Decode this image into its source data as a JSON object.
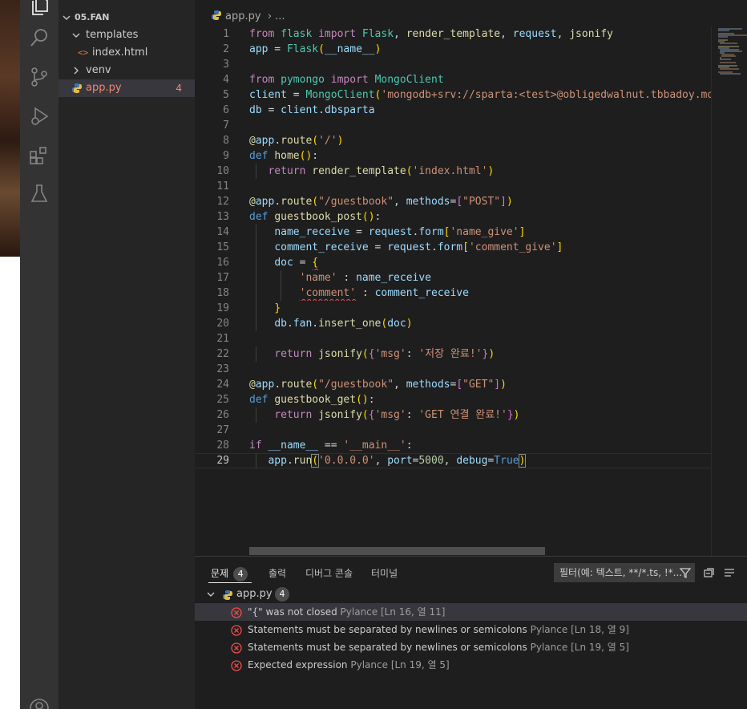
{
  "explorer": {
    "folder": "05.FAN",
    "items": [
      {
        "name": "templates",
        "type": "folder"
      },
      {
        "name": "index.html",
        "type": "html"
      },
      {
        "name": "venv",
        "type": "folder"
      },
      {
        "name": "app.py",
        "type": "python",
        "badge": "4"
      }
    ]
  },
  "editor": {
    "breadcrumb": {
      "file": "app.py",
      "rest": "..."
    },
    "code_lines": [
      "from flask import Flask, render_template, request, jsonify",
      "app = Flask(__name__)",
      "",
      "from pymongo import MongoClient",
      "client = MongoClient('mongodb+srv://sparta:<test>@obligedwalnut.tbbadoy.mon",
      "db = client.dbsparta",
      "",
      "@app.route('/')",
      "def home():",
      "    return render_template('index.html')",
      "",
      "@app.route(\"/guestbook\", methods=[\"POST\"])",
      "def guestbook_post():",
      "    name_receive = request.form['name_give']",
      "    comment_receive = request.form['comment_give']",
      "    doc = {",
      "        'name' : name_receive",
      "        'comment' : comment_receive",
      "    }",
      "    db.fan.insert_one(doc)",
      "",
      "    return jsonify({'msg': '저장 완료!'})",
      "",
      "@app.route(\"/guestbook\", methods=[\"GET\"])",
      "def guestbook_get():",
      "    return jsonify({'msg': 'GET 연결 완료!'})",
      "",
      "if __name__ == '__main__':",
      "    app.run('0.0.0.0', port=5000, debug=True)"
    ],
    "current_line": 29
  },
  "panel": {
    "tabs": [
      {
        "label": "문제",
        "count": "4"
      },
      {
        "label": "출력"
      },
      {
        "label": "디버그 콘솔"
      },
      {
        "label": "터미널"
      }
    ],
    "filter_placeholder": "필터(예: 텍스트, **/*.ts, !*...",
    "file": {
      "name": "app.py",
      "count": "4"
    },
    "problems": [
      {
        "message": "\"{\" was not closed",
        "source": "Pylance",
        "location": "[Ln 16, 열 11]"
      },
      {
        "message": "Statements must be separated by newlines or semicolons",
        "source": "Pylance",
        "location": "[Ln 18, 열 9]"
      },
      {
        "message": "Statements must be separated by newlines or semicolons",
        "source": "Pylance",
        "location": "[Ln 19, 열 5]"
      },
      {
        "message": "Expected expression",
        "source": "Pylance",
        "location": "[Ln 19, 열 5]"
      }
    ]
  },
  "colors": {
    "activity_bar": "#333333",
    "sidebar": "#252526",
    "editor_bg": "#1e1e1e",
    "error": "#f14c4c",
    "error_badge": "#f48771"
  },
  "icons": [
    "files-icon",
    "search-icon",
    "source-control-icon",
    "run-debug-icon",
    "extensions-icon",
    "testing-icon",
    "accounts-icon",
    "python-file-icon",
    "html-file-icon",
    "error-icon",
    "filter-icon",
    "collapse-all-icon",
    "view-as-tree-icon"
  ]
}
